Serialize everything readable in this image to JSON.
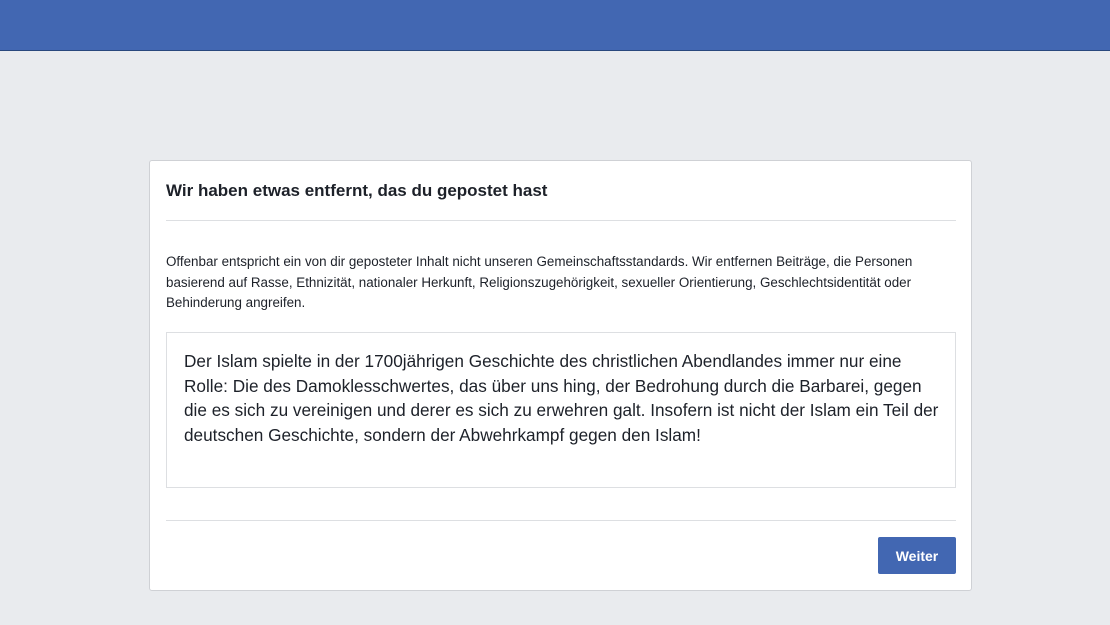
{
  "colors": {
    "topbar": "#4267b2",
    "page_background": "#e9ebee",
    "button": "#4267b2"
  },
  "dialog": {
    "title": "Wir haben etwas entfernt, das du gepostet hast",
    "intro": "Offenbar entspricht ein von dir geposteter Inhalt nicht unseren Gemeinschaftsstandards. Wir entfernen Beiträge, die Personen basierend auf Rasse, Ethnizität, nationaler Herkunft, Religionszugehörigkeit, sexueller Orientierung, Geschlechtsidentität oder Behinderung angreifen.",
    "removed_post": "Der Islam spielte in der 1700jährigen Geschichte des christlichen Abendlandes immer nur eine Rolle: Die des Damoklesschwertes, das über uns hing, der Bedrohung durch die Barbarei, gegen die es sich zu vereinigen und derer es sich zu erwehren galt. Insofern ist nicht der Islam ein Teil der deutschen Geschichte, sondern der Abwehrkampf gegen den Islam!",
    "continue_label": "Weiter"
  }
}
